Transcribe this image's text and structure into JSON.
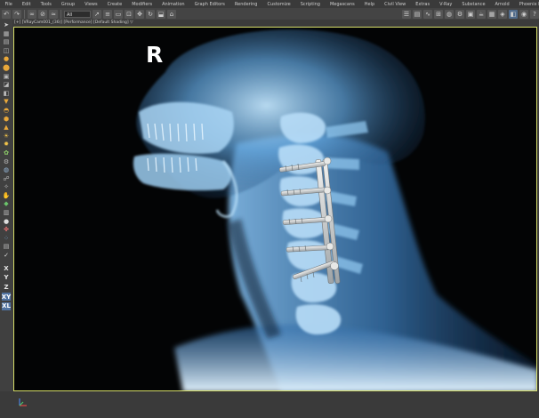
{
  "menubar": {
    "items": [
      "File",
      "Edit",
      "Tools",
      "Group",
      "Views",
      "Create",
      "Modifiers",
      "Animation",
      "Graph Editors",
      "Rendering",
      "Customize",
      "Scripting",
      "Megascans",
      "Help",
      "Civil View",
      "Extras",
      "V-Ray",
      "Substance",
      "Arnold",
      "Phoenix FD"
    ]
  },
  "toolbar": {
    "selection_filter": "All"
  },
  "viewport": {
    "label": "[+] [VRayCam001_(36)] [Performance] [Default Shading]",
    "filter_glyph": "▽",
    "image_marker": "R"
  },
  "axis_buttons": [
    "X",
    "Y",
    "Z",
    "XY",
    "XL"
  ],
  "colors": {
    "ui_background": "#3b3b3b",
    "viewport_border": "#d8e06a",
    "xray_tint": "#8fc6ee",
    "active_axis": "#5173a0"
  },
  "icons": {
    "toolbar": [
      "undo-icon",
      "redo-icon",
      "link-icon",
      "unlink-icon",
      "bind-spacewarp-icon",
      "select-icon",
      "select-by-name-icon",
      "rect-region-icon",
      "window-crossing-icon",
      "move-icon",
      "rotate-icon",
      "scale-icon",
      "place-icon"
    ],
    "toolbar_right": [
      "layer-explorer-icon",
      "toggle-ribbon-icon",
      "curve-editor-icon",
      "schematic-icon",
      "material-editor-icon",
      "render-setup-icon",
      "render-frame-icon",
      "render-icon",
      "vray-frame-buffer-icon",
      "vray-render-icon",
      "active-shade-icon",
      "viewport-settings-icon",
      "help-icon"
    ]
  }
}
